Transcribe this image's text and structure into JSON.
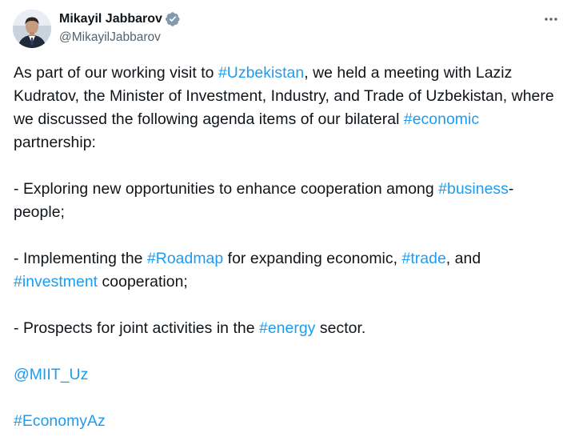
{
  "author": {
    "display_name": "Mikayil Jabbarov",
    "handle": "@MikayilJabbarov",
    "verified_icon": "verified-badge-icon",
    "verified_color": "#829aab"
  },
  "more_icon": "more-options-icon",
  "colors": {
    "link": "#1d9bf0",
    "text": "#0f1419",
    "secondary": "#536471"
  },
  "content": {
    "p1": {
      "t1": "As part of our working visit to ",
      "tag1": "#Uzbekistan",
      "t2": ", we held a meeting with Laziz Kudratov, the Minister of Investment, Industry, and Trade of Uzbekistan, where we discussed the following agenda items of our bilateral ",
      "tag2": "#economic",
      "t3": " partnership:"
    },
    "p2": {
      "t1": "- Exploring new opportunities to enhance cooperation among ",
      "tag1": "#business",
      "t2": "-people;"
    },
    "p3": {
      "t1": "- Implementing the ",
      "tag1": "#Roadmap",
      "t2": " for expanding economic, ",
      "tag2": "#trade",
      "t3": ", and ",
      "tag3": "#investment",
      "t4": " cooperation;"
    },
    "p4": {
      "t1": "- Prospects for joint activities in the ",
      "tag1": "#energy",
      "t2": " sector."
    },
    "mention": "@MIIT_Uz",
    "hashtag_final": "#EconomyAz"
  }
}
